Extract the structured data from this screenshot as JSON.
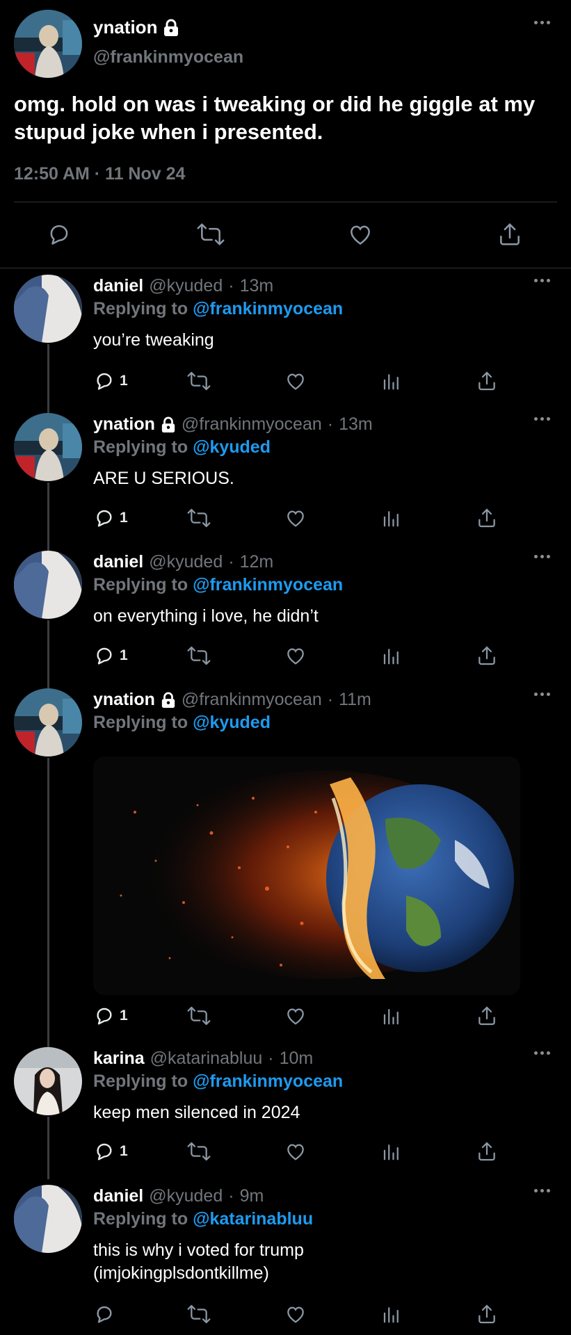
{
  "main_tweet": {
    "name": "ynation",
    "handle": "@frankinmyocean",
    "text": "omg. hold on was i tweaking or did he giggle at my stupud joke when i presented.",
    "timestamp": "12:50 AM · 11 Nov 24"
  },
  "replies": [
    {
      "name": "daniel",
      "handle": "@kyuded",
      "time": "13m",
      "replying_label": "Replying to",
      "replying_to": "@frankinmyocean",
      "text": "you’re tweaking",
      "reply_count": "1"
    },
    {
      "name": "ynation",
      "handle": "@frankinmyocean",
      "time": "13m",
      "replying_label": "Replying to",
      "replying_to": "@kyuded",
      "text": "ARE U SERIOUS.",
      "reply_count": "1"
    },
    {
      "name": "daniel",
      "handle": "@kyuded",
      "time": "12m",
      "replying_label": "Replying to",
      "replying_to": "@frankinmyocean",
      "text": "on everything i love, he didn’t",
      "reply_count": "1"
    },
    {
      "name": "ynation",
      "handle": "@frankinmyocean",
      "time": "11m",
      "replying_label": "Replying to",
      "replying_to": "@kyuded",
      "text": "",
      "reply_count": "1"
    },
    {
      "name": "karina",
      "handle": "@katarinabluu",
      "time": "10m",
      "replying_label": "Replying to",
      "replying_to": "@frankinmyocean",
      "text": "keep men silenced in 2024",
      "reply_count": "1"
    },
    {
      "name": "daniel",
      "handle": "@kyuded",
      "time": "9m",
      "replying_label": "Replying to",
      "replying_to": "@katarinabluu",
      "text_line1": "this is why i voted for trump",
      "text_line2": "(imjokingplsdontkillme)",
      "reply_count": ""
    }
  ],
  "separator": "·",
  "colors": {
    "background": "#000000",
    "text": "#e7e9ea",
    "muted": "#71767b",
    "accent": "#1d9bf0",
    "divider": "#2f3336"
  },
  "icons": [
    "lock-icon",
    "more-icon",
    "reply-icon",
    "retweet-icon",
    "like-icon",
    "views-icon",
    "share-icon"
  ]
}
